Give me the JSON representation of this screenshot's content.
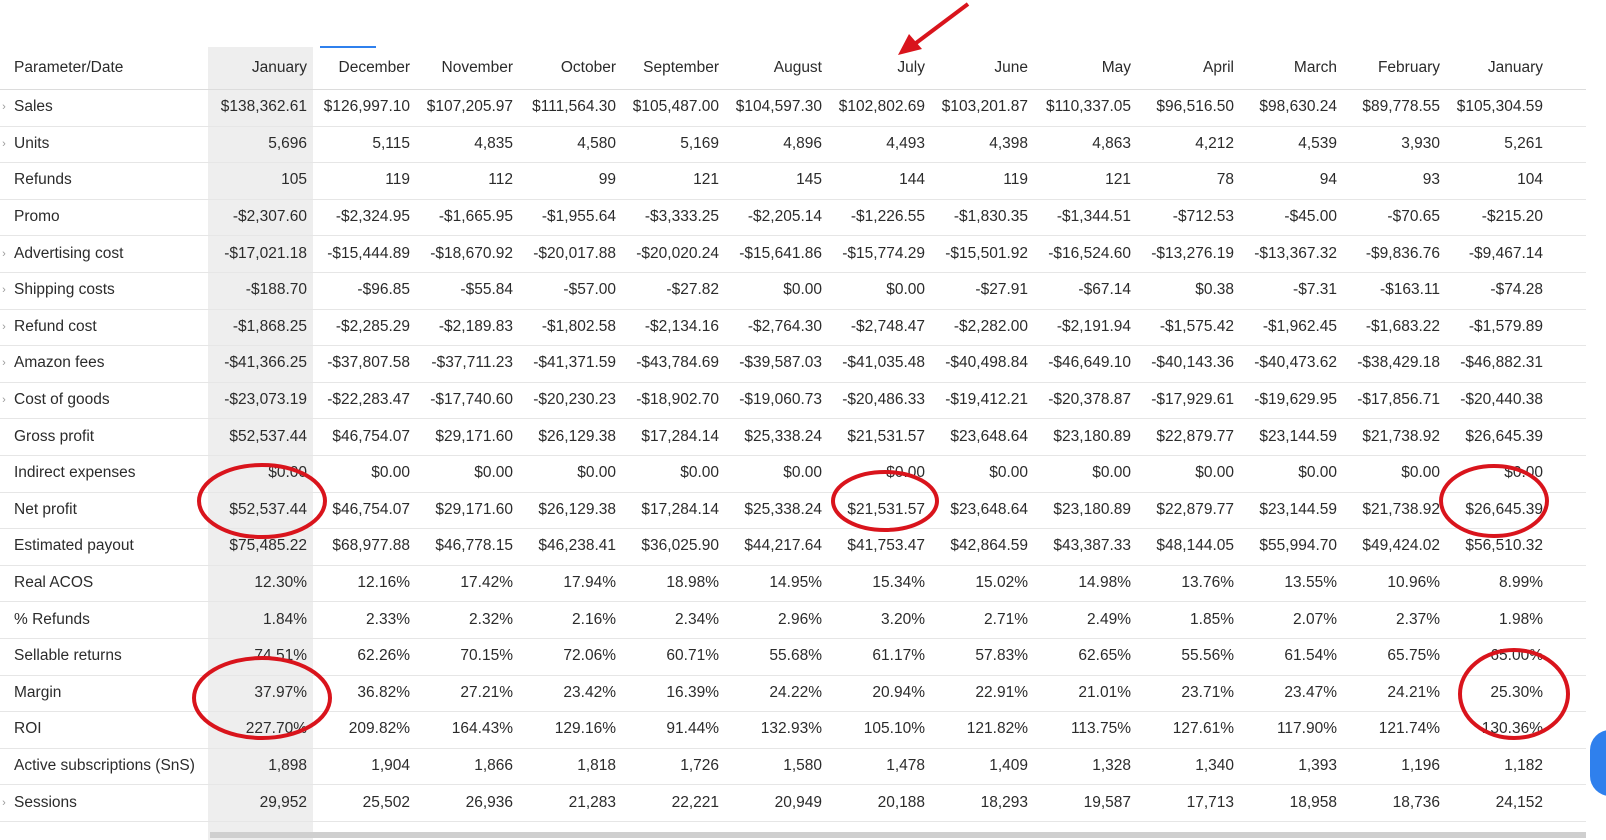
{
  "header": {
    "param_label": "Parameter/Date",
    "columns": [
      "January",
      "December",
      "November",
      "October",
      "September",
      "August",
      "July",
      "June",
      "May",
      "April",
      "March",
      "February",
      "January"
    ]
  },
  "rows": [
    {
      "name": "Sales",
      "expand": true,
      "values": [
        "$138,362.61",
        "$126,997.10",
        "$107,205.97",
        "$111,564.30",
        "$105,487.00",
        "$104,597.30",
        "$102,802.69",
        "$103,201.87",
        "$110,337.05",
        "$96,516.50",
        "$98,630.24",
        "$89,778.55",
        "$105,304.59"
      ]
    },
    {
      "name": "Units",
      "expand": true,
      "values": [
        "5,696",
        "5,115",
        "4,835",
        "4,580",
        "5,169",
        "4,896",
        "4,493",
        "4,398",
        "4,863",
        "4,212",
        "4,539",
        "3,930",
        "5,261"
      ]
    },
    {
      "name": "Refunds",
      "expand": false,
      "values": [
        "105",
        "119",
        "112",
        "99",
        "121",
        "145",
        "144",
        "119",
        "121",
        "78",
        "94",
        "93",
        "104"
      ]
    },
    {
      "name": "Promo",
      "expand": false,
      "values": [
        "-$2,307.60",
        "-$2,324.95",
        "-$1,665.95",
        "-$1,955.64",
        "-$3,333.25",
        "-$2,205.14",
        "-$1,226.55",
        "-$1,830.35",
        "-$1,344.51",
        "-$712.53",
        "-$45.00",
        "-$70.65",
        "-$215.20"
      ]
    },
    {
      "name": "Advertising cost",
      "expand": true,
      "values": [
        "-$17,021.18",
        "-$15,444.89",
        "-$18,670.92",
        "-$20,017.88",
        "-$20,020.24",
        "-$15,641.86",
        "-$15,774.29",
        "-$15,501.92",
        "-$16,524.60",
        "-$13,276.19",
        "-$13,367.32",
        "-$9,836.76",
        "-$9,467.14"
      ]
    },
    {
      "name": "Shipping costs",
      "expand": true,
      "values": [
        "-$188.70",
        "-$96.85",
        "-$55.84",
        "-$57.00",
        "-$27.82",
        "$0.00",
        "$0.00",
        "-$27.91",
        "-$67.14",
        "$0.38",
        "-$7.31",
        "-$163.11",
        "-$74.28"
      ]
    },
    {
      "name": "Refund cost",
      "expand": true,
      "values": [
        "-$1,868.25",
        "-$2,285.29",
        "-$2,189.83",
        "-$1,802.58",
        "-$2,134.16",
        "-$2,764.30",
        "-$2,748.47",
        "-$2,282.00",
        "-$2,191.94",
        "-$1,575.42",
        "-$1,962.45",
        "-$1,683.22",
        "-$1,579.89"
      ]
    },
    {
      "name": "Amazon fees",
      "expand": true,
      "values": [
        "-$41,366.25",
        "-$37,807.58",
        "-$37,711.23",
        "-$41,371.59",
        "-$43,784.69",
        "-$39,587.03",
        "-$41,035.48",
        "-$40,498.84",
        "-$46,649.10",
        "-$40,143.36",
        "-$40,473.62",
        "-$38,429.18",
        "-$46,882.31"
      ]
    },
    {
      "name": "Cost of goods",
      "expand": true,
      "values": [
        "-$23,073.19",
        "-$22,283.47",
        "-$17,740.60",
        "-$20,230.23",
        "-$18,902.70",
        "-$19,060.73",
        "-$20,486.33",
        "-$19,412.21",
        "-$20,378.87",
        "-$17,929.61",
        "-$19,629.95",
        "-$17,856.71",
        "-$20,440.38"
      ]
    },
    {
      "name": "Gross profit",
      "expand": false,
      "values": [
        "$52,537.44",
        "$46,754.07",
        "$29,171.60",
        "$26,129.38",
        "$17,284.14",
        "$25,338.24",
        "$21,531.57",
        "$23,648.64",
        "$23,180.89",
        "$22,879.77",
        "$23,144.59",
        "$21,738.92",
        "$26,645.39"
      ]
    },
    {
      "name": "Indirect expenses",
      "expand": false,
      "values": [
        "$0.00",
        "$0.00",
        "$0.00",
        "$0.00",
        "$0.00",
        "$0.00",
        "$0.00",
        "$0.00",
        "$0.00",
        "$0.00",
        "$0.00",
        "$0.00",
        "$0.00"
      ]
    },
    {
      "name": "Net profit",
      "expand": false,
      "values": [
        "$52,537.44",
        "$46,754.07",
        "$29,171.60",
        "$26,129.38",
        "$17,284.14",
        "$25,338.24",
        "$21,531.57",
        "$23,648.64",
        "$23,180.89",
        "$22,879.77",
        "$23,144.59",
        "$21,738.92",
        "$26,645.39"
      ]
    },
    {
      "name": "Estimated payout",
      "expand": false,
      "values": [
        "$75,485.22",
        "$68,977.88",
        "$46,778.15",
        "$46,238.41",
        "$36,025.90",
        "$44,217.64",
        "$41,753.47",
        "$42,864.59",
        "$43,387.33",
        "$48,144.05",
        "$55,994.70",
        "$49,424.02",
        "$56,510.32"
      ]
    },
    {
      "name": "Real ACOS",
      "expand": false,
      "values": [
        "12.30%",
        "12.16%",
        "17.42%",
        "17.94%",
        "18.98%",
        "14.95%",
        "15.34%",
        "15.02%",
        "14.98%",
        "13.76%",
        "13.55%",
        "10.96%",
        "8.99%"
      ]
    },
    {
      "name": "% Refunds",
      "expand": false,
      "values": [
        "1.84%",
        "2.33%",
        "2.32%",
        "2.16%",
        "2.34%",
        "2.96%",
        "3.20%",
        "2.71%",
        "2.49%",
        "1.85%",
        "2.07%",
        "2.37%",
        "1.98%"
      ]
    },
    {
      "name": "Sellable returns",
      "expand": false,
      "values": [
        "74.51%",
        "62.26%",
        "70.15%",
        "72.06%",
        "60.71%",
        "55.68%",
        "61.17%",
        "57.83%",
        "62.65%",
        "55.56%",
        "61.54%",
        "65.75%",
        "65.00%"
      ]
    },
    {
      "name": "Margin",
      "expand": false,
      "values": [
        "37.97%",
        "36.82%",
        "27.21%",
        "23.42%",
        "16.39%",
        "24.22%",
        "20.94%",
        "22.91%",
        "21.01%",
        "23.71%",
        "23.47%",
        "24.21%",
        "25.30%"
      ]
    },
    {
      "name": "ROI",
      "expand": false,
      "values": [
        "227.70%",
        "209.82%",
        "164.43%",
        "129.16%",
        "91.44%",
        "132.93%",
        "105.10%",
        "121.82%",
        "113.75%",
        "127.61%",
        "117.90%",
        "121.74%",
        "130.36%"
      ]
    },
    {
      "name": "Active subscriptions (SnS)",
      "expand": false,
      "values": [
        "1,898",
        "1,904",
        "1,866",
        "1,818",
        "1,726",
        "1,580",
        "1,478",
        "1,409",
        "1,328",
        "1,340",
        "1,393",
        "1,196",
        "1,182"
      ]
    },
    {
      "name": "Sessions",
      "expand": true,
      "values": [
        "29,952",
        "25,502",
        "26,936",
        "21,283",
        "22,221",
        "20,949",
        "20,188",
        "18,293",
        "19,587",
        "17,713",
        "18,958",
        "18,736",
        "24,152"
      ]
    }
  ],
  "annotations": {
    "circle_color": "#d9141c",
    "arrow_color": "#d9141c"
  },
  "colors": {
    "selected_column_bg": "#eeeeee",
    "active_tab_accent": "#2f80ed"
  }
}
